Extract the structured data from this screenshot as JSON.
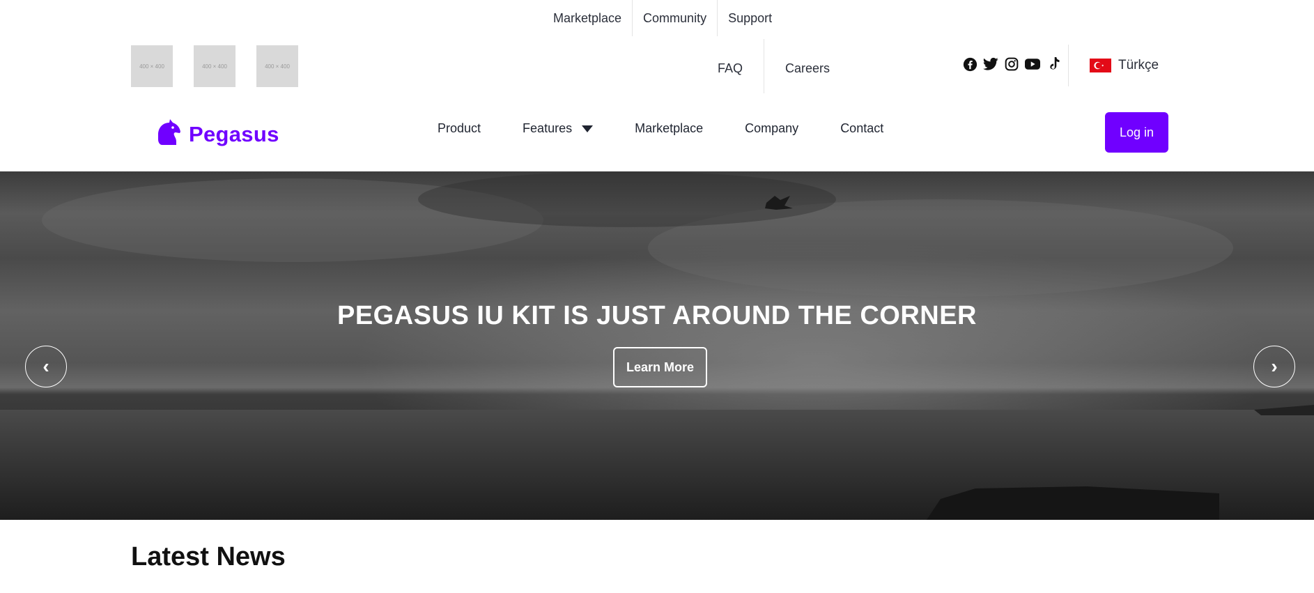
{
  "topbar": {
    "links": [
      "Marketplace",
      "Community",
      "Support"
    ]
  },
  "placeholders": [
    "400 × 400",
    "400 × 400",
    "400 × 400"
  ],
  "row2": {
    "links": [
      "FAQ",
      "Careers"
    ],
    "socials": [
      "facebook-icon",
      "twitter-icon",
      "instagram-icon",
      "youtube-icon",
      "tiktok-icon"
    ],
    "language": {
      "flag": "turkey-flag-icon",
      "label": "Türkçe"
    }
  },
  "nav": {
    "brand": "Pegasus",
    "items": [
      "Product",
      "Features",
      "Marketplace",
      "Company",
      "Contact"
    ],
    "login": "Log in"
  },
  "hero": {
    "title": "PEGASUS IU KIT IS JUST AROUND THE CORNER",
    "cta": "Learn More",
    "prev_icon": "‹",
    "next_icon": "›"
  },
  "news": {
    "heading": "Latest News"
  },
  "colors": {
    "brand": "#7000ff",
    "text": "#1f2430",
    "flag_red": "#e30a17"
  }
}
